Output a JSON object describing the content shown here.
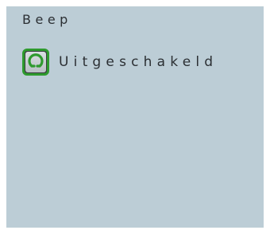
{
  "setting": {
    "title": "Beep",
    "option_label": "Uitgeschakeld",
    "icon": "power-ring-icon",
    "colors": {
      "background": "#bccdd6",
      "toggle_border": "#2e9a2e",
      "icon_green": "#2e9a2e",
      "text": "#2b2f33"
    }
  }
}
